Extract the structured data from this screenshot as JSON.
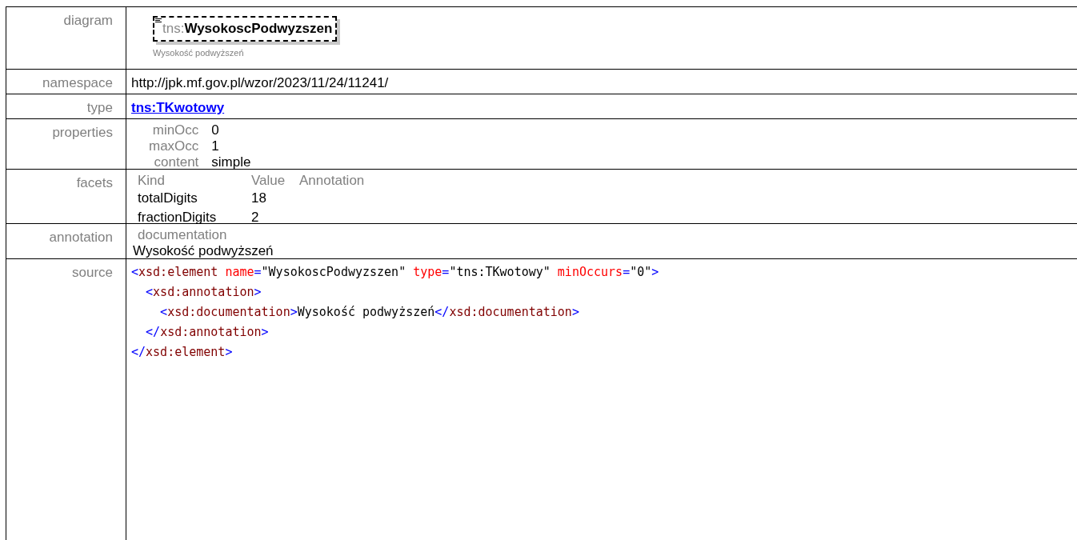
{
  "diagram": {
    "prefix": "tns:",
    "name": "WysokoscPodwyzszen",
    "caption": "Wysokość podwyższeń"
  },
  "rows": [
    {
      "kind": "text",
      "label": "namespace",
      "value": "http://jpk.mf.gov.pl/wzor/2023/11/24/11241/"
    },
    {
      "kind": "link",
      "label": "type",
      "value": "tns:TKwotowy"
    }
  ],
  "diagram_label": "diagram",
  "properties": {
    "label": "properties",
    "items": [
      {
        "name": "minOcc",
        "value": "0"
      },
      {
        "name": "maxOcc",
        "value": "1"
      },
      {
        "name": "content",
        "value": "simple"
      }
    ]
  },
  "facets": {
    "label": "facets",
    "columns": [
      "Kind",
      "Value",
      "Annotation"
    ],
    "items": [
      {
        "kind": "totalDigits",
        "value": "18"
      },
      {
        "kind": "fractionDigits",
        "value": "2"
      }
    ]
  },
  "annotation": {
    "label": "annotation",
    "heading": "documentation",
    "text": "Wysokość podwyższeń"
  },
  "source": {
    "label": "source",
    "lines": [
      [
        {
          "kind": "bracket",
          "text": "<"
        },
        {
          "kind": "tag",
          "text": "xsd:element"
        },
        {
          "kind": "attr",
          "text": " name"
        },
        {
          "kind": "bracket",
          "text": "="
        },
        {
          "kind": "value",
          "text": "\"WysokoscPodwyzszen\""
        },
        {
          "kind": "attr",
          "text": " type"
        },
        {
          "kind": "bracket",
          "text": "="
        },
        {
          "kind": "value",
          "text": "\"tns:TKwotowy\""
        },
        {
          "kind": "attr",
          "text": " minOccurs"
        },
        {
          "kind": "bracket",
          "text": "="
        },
        {
          "kind": "value",
          "text": "\"0\""
        },
        {
          "kind": "bracket",
          "text": ">"
        }
      ],
      [
        {
          "kind": "bracket",
          "text": "  <"
        },
        {
          "kind": "tag",
          "text": "xsd:annotation"
        },
        {
          "kind": "bracket",
          "text": ">"
        }
      ],
      [
        {
          "kind": "bracket",
          "text": "    <"
        },
        {
          "kind": "tag",
          "text": "xsd:documentation"
        },
        {
          "kind": "bracket",
          "text": ">"
        },
        {
          "kind": "plain",
          "text": "Wysokość podwyższeń"
        },
        {
          "kind": "bracket",
          "text": "</"
        },
        {
          "kind": "tag",
          "text": "xsd:documentation"
        },
        {
          "kind": "bracket",
          "text": ">"
        }
      ],
      [
        {
          "kind": "bracket",
          "text": "  </"
        },
        {
          "kind": "tag",
          "text": "xsd:annotation"
        },
        {
          "kind": "bracket",
          "text": ">"
        }
      ],
      [
        {
          "kind": "bracket",
          "text": "</"
        },
        {
          "kind": "tag",
          "text": "xsd:element"
        },
        {
          "kind": "bracket",
          "text": ">"
        }
      ]
    ]
  }
}
